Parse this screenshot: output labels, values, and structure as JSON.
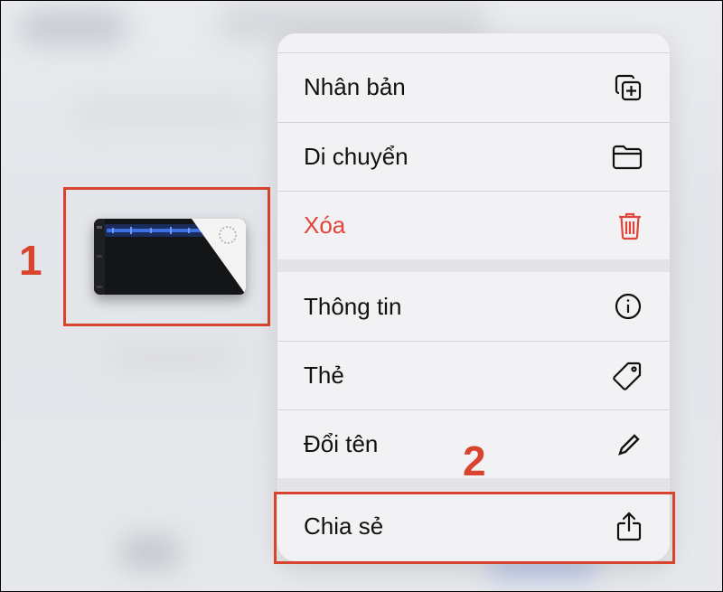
{
  "menu": {
    "items": [
      {
        "label": "Nhân bản",
        "icon": "duplicate-icon"
      },
      {
        "label": "Di chuyển",
        "icon": "folder-icon"
      },
      {
        "label": "Xóa",
        "icon": "trash-icon"
      },
      {
        "label": "Thông tin",
        "icon": "info-icon"
      },
      {
        "label": "Thẻ",
        "icon": "tag-icon"
      },
      {
        "label": "Đổi tên",
        "icon": "pencil-icon"
      },
      {
        "label": "Chia sẻ",
        "icon": "share-icon"
      }
    ]
  },
  "annotations": {
    "first": "1",
    "second": "2"
  },
  "colors": {
    "annotation": "#d9442f",
    "danger": "#e0453a",
    "menu_bg": "#f2f2f4"
  }
}
